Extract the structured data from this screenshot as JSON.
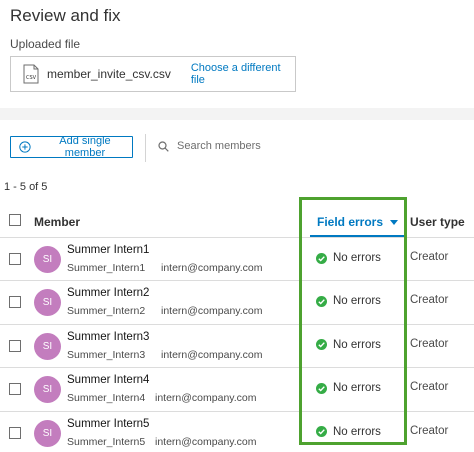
{
  "header": {
    "title": "Review and fix",
    "uploaded_label": "Uploaded file"
  },
  "file": {
    "name": "member_invite_csv.csv",
    "icon_text": "CSV",
    "change_link": "Choose a different file"
  },
  "toolbar": {
    "add_label": "Add single member",
    "search_placeholder": "Search members"
  },
  "table": {
    "count": "1 - 5 of 5",
    "columns": {
      "member": "Member",
      "field_errors": "Field errors",
      "user_type": "User type"
    },
    "rows": [
      {
        "initials": "SI",
        "name": "Summer Intern1",
        "username": "Summer_Intern1",
        "email": "intern@company.com",
        "status": "No errors",
        "user_type": "Creator"
      },
      {
        "initials": "SI",
        "name": "Summer Intern2",
        "username": "Summer_Intern2",
        "email": "intern@company.com",
        "status": "No errors",
        "user_type": "Creator"
      },
      {
        "initials": "SI",
        "name": "Summer Intern3",
        "username": "Summer_Intern3",
        "email": "intern@company.com",
        "status": "No errors",
        "user_type": "Creator"
      },
      {
        "initials": "SI",
        "name": "Summer Intern4",
        "username": "Summer_Intern4",
        "email": "intern@company.com",
        "status": "No errors",
        "user_type": "Creator"
      },
      {
        "initials": "SI",
        "name": "Summer Intern5",
        "username": "Summer_Intern5",
        "email": "intern@company.com",
        "status": "No errors",
        "user_type": "Creator"
      }
    ]
  },
  "colors": {
    "accent": "#0079c1",
    "success": "#35ac46",
    "avatar": "#c37dbe",
    "highlight": "#4ea22f"
  }
}
